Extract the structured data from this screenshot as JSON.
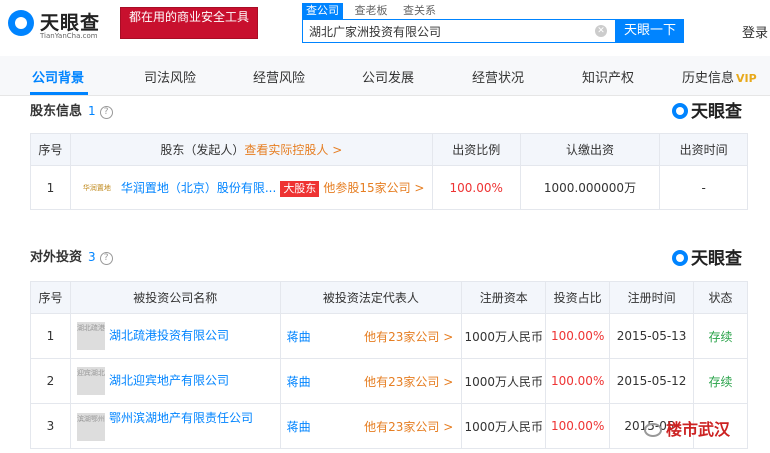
{
  "header": {
    "logo_name": "天眼查",
    "logo_domain": "TianYanCha.com",
    "slogan": "都在用的商业安全工具",
    "search_tabs": [
      "查公司",
      "查老板",
      "查关系"
    ],
    "search_value": "湖北广家洲投资有限公司",
    "search_button": "天眼一下",
    "login": "登录"
  },
  "nav": {
    "items": [
      "公司背景",
      "司法风险",
      "经营风险",
      "公司发展",
      "经营状况",
      "知识产权",
      "历史信息"
    ],
    "vip": "VIP"
  },
  "brand": "天眼查",
  "shareholders": {
    "title": "股东信息",
    "count": "1",
    "headers": [
      "序号",
      "股东（发起人）",
      "查看实际控股人 >",
      "出资比例",
      "认缴出资",
      "出资时间"
    ],
    "rows": [
      {
        "no": "1",
        "logo_text": "华润置地",
        "name": "华润置地（北京）股份有限...",
        "tag": "大股东",
        "related": "他参股15家公司 >",
        "ratio": "100.00%",
        "amount": "1000.000000万",
        "date": "-"
      }
    ]
  },
  "investments": {
    "title": "对外投资",
    "count": "3",
    "headers": [
      "序号",
      "被投资公司名称",
      "被投资法定代表人",
      "注册资本",
      "投资占比",
      "注册时间",
      "状态"
    ],
    "rows": [
      {
        "no": "1",
        "logo_text": "湖北疏港",
        "company": "湖北疏港投资有限公司",
        "rep": "蒋曲",
        "rep_count": "他有23家公司 >",
        "capital": "1000万人民币",
        "ratio": "100.00%",
        "date": "2015-05-13",
        "status": "存续"
      },
      {
        "no": "2",
        "logo_text": "迎宾湖北",
        "company": "湖北迎宾地产有限公司",
        "rep": "蒋曲",
        "rep_count": "他有23家公司 >",
        "capital": "1000万人民币",
        "ratio": "100.00%",
        "date": "2015-05-12",
        "status": "存续"
      },
      {
        "no": "3",
        "logo_text": "滨湖鄂州",
        "company": "鄂州滨湖地产有限责任公司",
        "rep": "蒋曲",
        "rep_count": "他有23家公司 >",
        "capital": "1000万人民币",
        "ratio": "100.00%",
        "date": "2015-05-",
        "status": ""
      }
    ]
  },
  "watermark": "楼市武汉",
  "colors": {
    "accent": "#0084ff",
    "slogan_bg": "#c8102e",
    "red": "#ee3333",
    "orange": "#e67e22",
    "green": "#2aa34a"
  }
}
